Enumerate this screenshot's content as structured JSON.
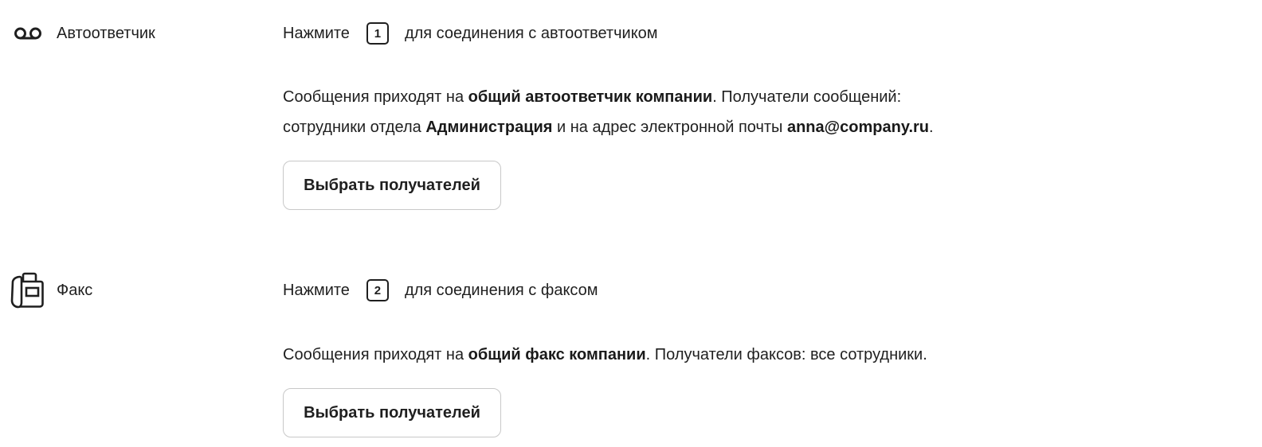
{
  "voicemail": {
    "icon": "voicemail-icon",
    "label": "Автоответчик",
    "press_prefix": "Нажмите",
    "key": "1",
    "press_suffix": "для соединения с автоответчиком",
    "desc": {
      "t1": "Сообщения приходят на ",
      "b1": "общий автоответчик компании",
      "t2": ". Получатели сообщений:",
      "t3": "сотрудники отдела ",
      "b2": "Администрация",
      "t4": " и на адрес электронной почты ",
      "b3": "anna@company.ru",
      "t5": "."
    },
    "button_label": "Выбрать получателей"
  },
  "fax": {
    "icon": "fax-icon",
    "label": "Факс",
    "press_prefix": "Нажмите",
    "key": "2",
    "press_suffix": "для соединения с факсом",
    "desc": {
      "t1": "Сообщения приходят на ",
      "b1": "общий факс компании",
      "t2": ". Получатели факсов: все сотрудники."
    },
    "button_label": "Выбрать получателей"
  },
  "colors": {
    "text": "#1f1f1f",
    "button_border": "#c8c8c8",
    "background": "#ffffff"
  }
}
